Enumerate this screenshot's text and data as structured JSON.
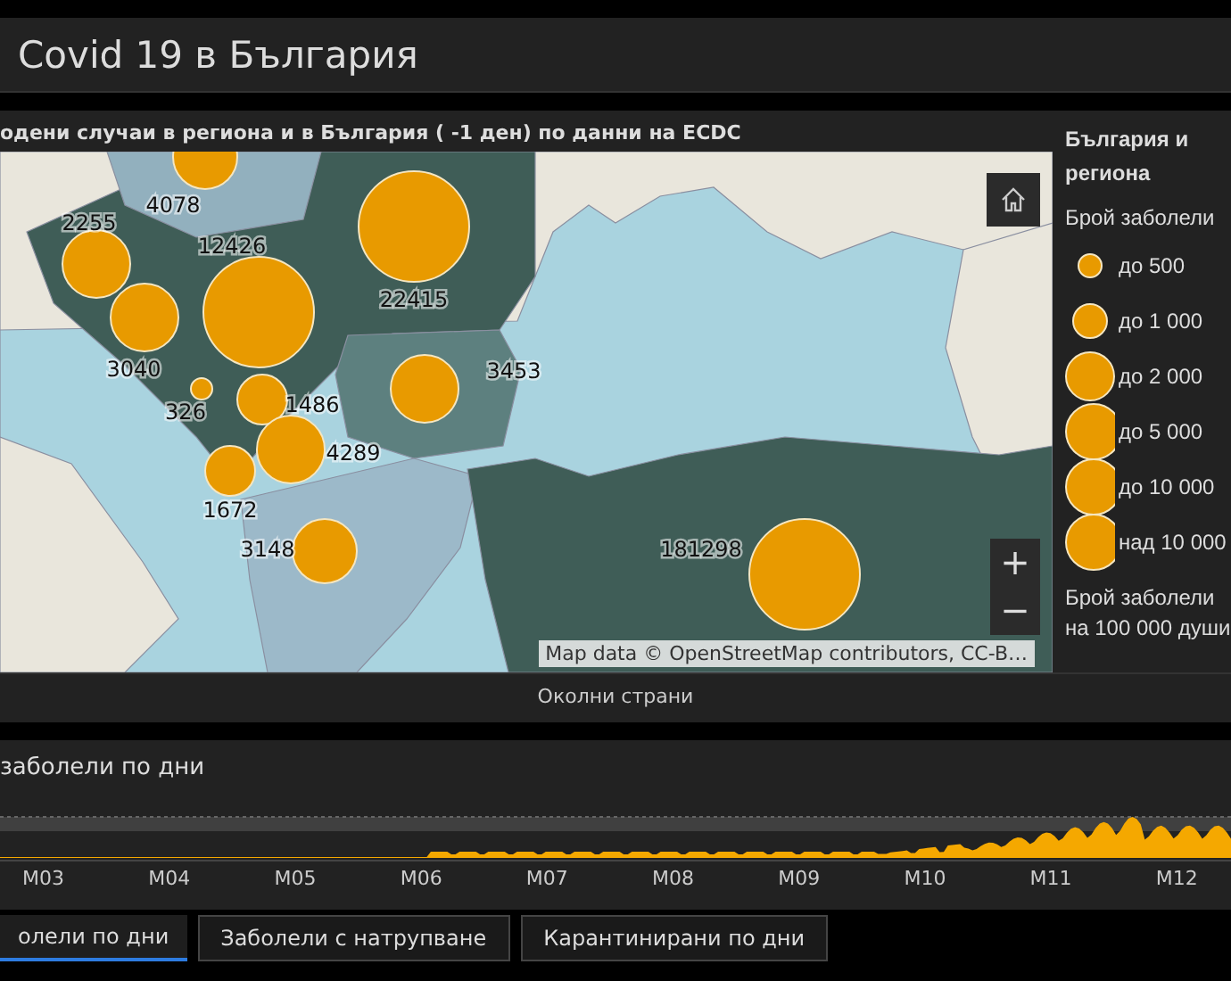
{
  "header": {
    "title": "Covid 19 в България"
  },
  "map_panel": {
    "title": "одени случаи в региона и в България ( -1 ден) по данни на ECDC",
    "markers": [
      {
        "label": "4078"
      },
      {
        "label": "2255"
      },
      {
        "label": "3040"
      },
      {
        "label": "12426"
      },
      {
        "label": "22415"
      },
      {
        "label": "326"
      },
      {
        "label": "1486"
      },
      {
        "label": "4289"
      },
      {
        "label": "3453"
      },
      {
        "label": "1672"
      },
      {
        "label": "3148"
      },
      {
        "label": "181298"
      }
    ],
    "zoom_in": "+",
    "zoom_out": "−",
    "attribution": "Map data © OpenStreetMap contributors, CC-B…",
    "legend": {
      "title": "България и региона",
      "size_heading": "Брой заболели",
      "items": [
        {
          "label": "до 500"
        },
        {
          "label": "до 1 000"
        },
        {
          "label": "до 2 000"
        },
        {
          "label": "до 5 000"
        },
        {
          "label": "до 10 000"
        },
        {
          "label": "над 10 000"
        }
      ],
      "rate_heading": "Брой заболели на 100 000 души"
    },
    "footer_tab": "Околни страни"
  },
  "chart_panel": {
    "title": "заболели по дни",
    "x_labels": [
      "M03",
      "M04",
      "M05",
      "M06",
      "M07",
      "M08",
      "M09",
      "M10",
      "M11",
      "M12"
    ],
    "tabs": [
      {
        "label": "олели по дни",
        "selected": true
      },
      {
        "label": "Заболели с натрупване",
        "selected": false
      },
      {
        "label": "Карантинирани по дни",
        "selected": false
      }
    ]
  }
}
